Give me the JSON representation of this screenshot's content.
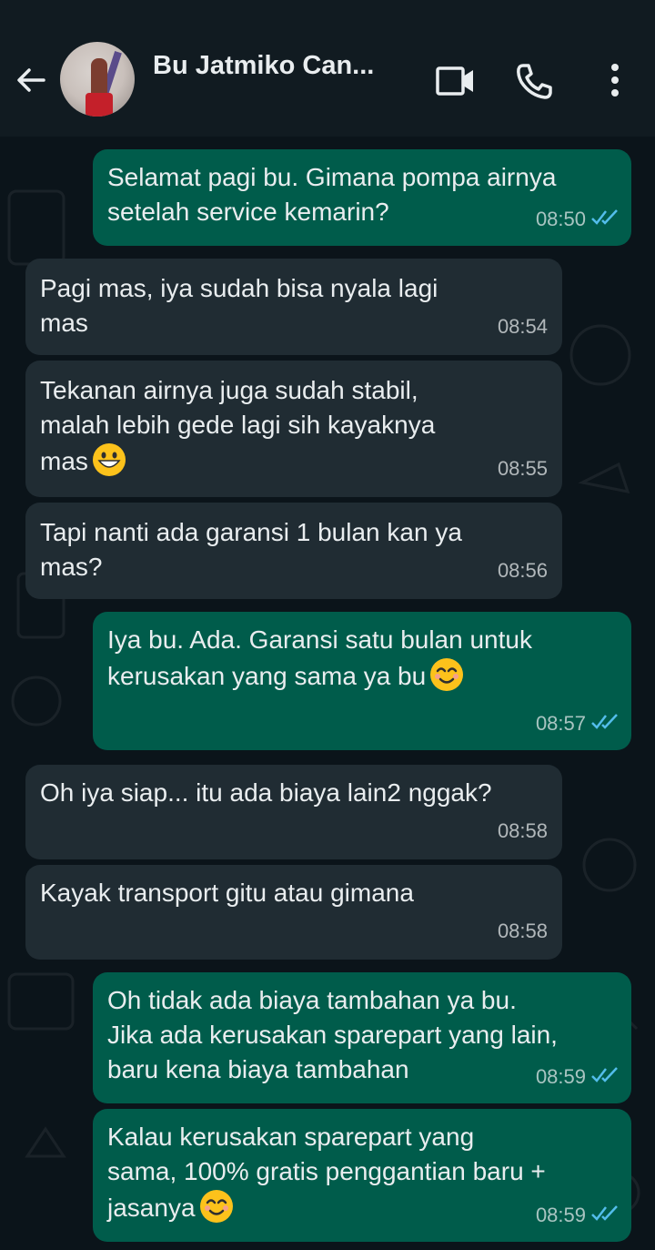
{
  "header": {
    "contact_name": "Bu Jatmiko Can...",
    "icons": [
      "back-arrow-icon",
      "video-call-icon",
      "phone-icon",
      "more-options-icon"
    ]
  },
  "colors": {
    "header_bg": "#111b21",
    "chat_bg": "#0b141a",
    "outgoing_bubble": "#005c4b",
    "incoming_bubble": "#202c33",
    "read_tick": "#53bdeb"
  },
  "messages": [
    {
      "direction": "out",
      "lines": [
        "Selamat pagi bu. Gimana pompa airnya",
        "setelah service kemarin?"
      ],
      "time": "08:50",
      "status": "read"
    },
    {
      "direction": "in",
      "lines": [
        "Pagi mas, iya sudah bisa nyala lagi",
        "mas"
      ],
      "time": "08:54"
    },
    {
      "direction": "in",
      "lines": [
        "Tekanan airnya juga sudah stabil,",
        "malah lebih gede lagi sih kayaknya",
        "mas"
      ],
      "emoji": "grinning-face-icon",
      "time": "08:55"
    },
    {
      "direction": "in",
      "lines": [
        "Tapi nanti ada garansi 1 bulan kan ya",
        "mas?"
      ],
      "time": "08:56"
    },
    {
      "direction": "out",
      "lines": [
        "Iya bu. Ada. Garansi satu bulan untuk",
        "kerusakan yang sama ya bu"
      ],
      "emoji": "smiling-face-icon",
      "time": "08:57",
      "status": "read"
    },
    {
      "direction": "in",
      "lines": [
        "Oh iya siap... itu ada biaya lain2 nggak?"
      ],
      "time": "08:58"
    },
    {
      "direction": "in",
      "lines": [
        "Kayak transport gitu atau gimana"
      ],
      "time": "08:58"
    },
    {
      "direction": "out",
      "lines": [
        "Oh tidak ada biaya tambahan ya bu.",
        "Jika ada kerusakan sparepart yang lain,",
        "baru kena biaya tambahan"
      ],
      "time": "08:59",
      "status": "read"
    },
    {
      "direction": "out",
      "lines": [
        "Kalau kerusakan sparepart yang",
        "sama, 100% gratis penggantian baru +",
        "jasanya"
      ],
      "emoji": "smiling-face-icon",
      "time": "08:59",
      "status": "read"
    }
  ]
}
